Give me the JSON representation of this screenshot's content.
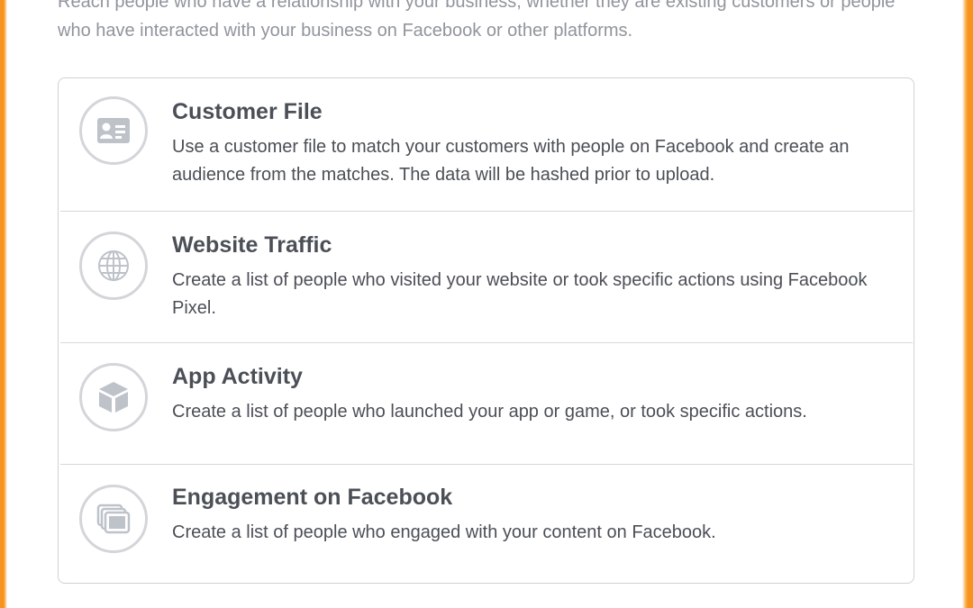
{
  "intro": {
    "text": "Reach people who have a relationship with your business, whether they are existing customers or people who have interacted with your business on Facebook or other platforms."
  },
  "options": [
    {
      "title": "Customer File",
      "description": "Use a customer file to match your customers with people on Facebook and create an audience from the matches. The data will be hashed prior to upload.",
      "icon": "contact-card-icon"
    },
    {
      "title": "Website Traffic",
      "description": "Create a list of people who visited your website or took specific actions using Facebook Pixel.",
      "icon": "globe-icon"
    },
    {
      "title": "App Activity",
      "description": "Create a list of people who launched your app or game, or took specific actions.",
      "icon": "cube-icon"
    },
    {
      "title": "Engagement on Facebook",
      "description": "Create a list of people who engaged with your content on Facebook.",
      "icon": "stacked-posts-icon"
    }
  ],
  "colors": {
    "accent_border": "#f7941d",
    "text": "#4b4f56",
    "muted_text": "#90949c",
    "icon": "#bec2c9"
  }
}
